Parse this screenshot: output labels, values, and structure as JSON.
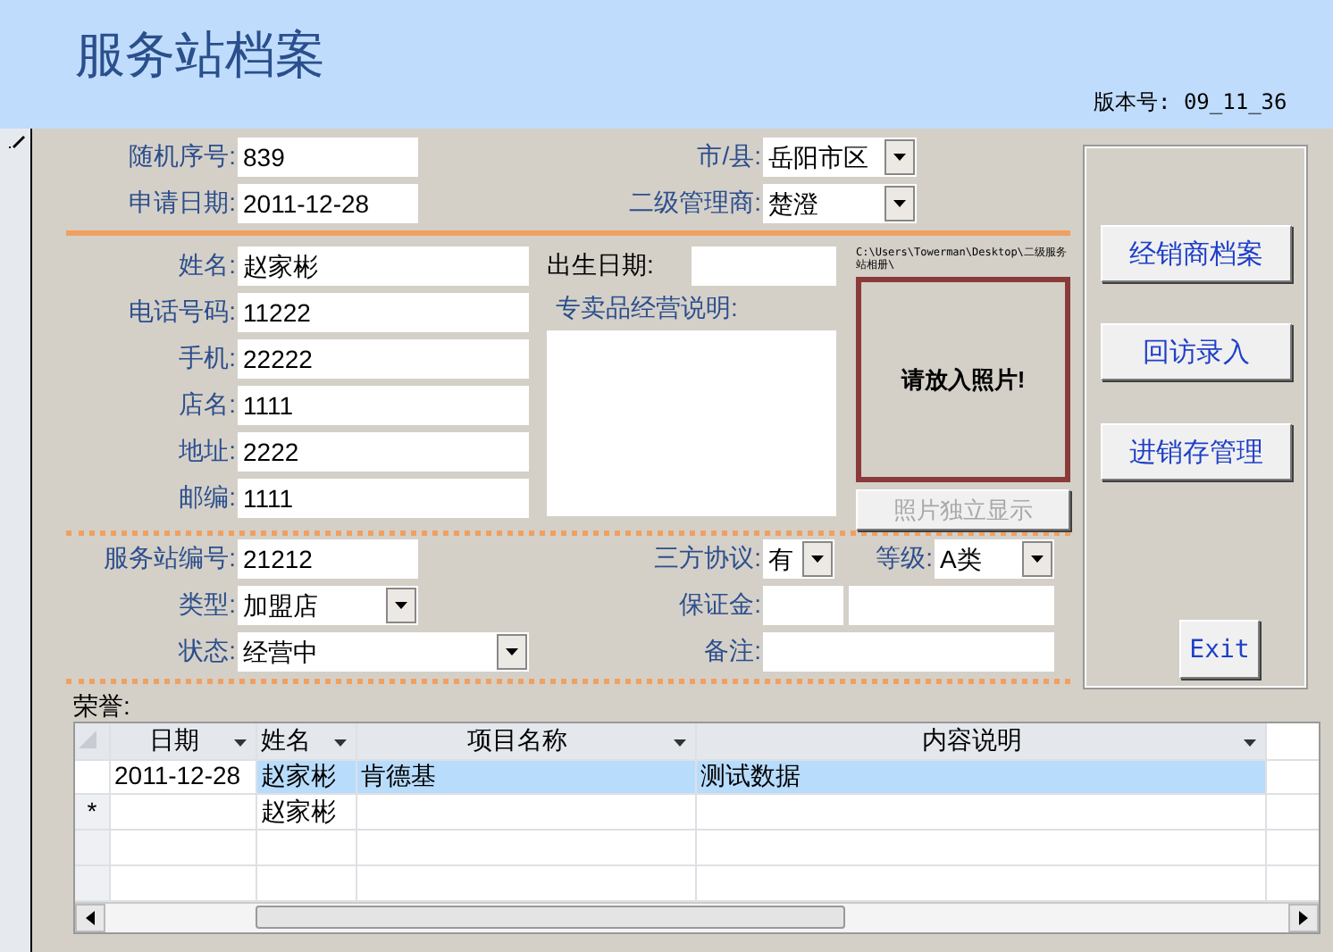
{
  "header": {
    "title": "服务站档案",
    "version": "版本号: 09_11_36"
  },
  "top_fields": [
    {
      "label": "随机序号:",
      "value": "839",
      "kind": "text"
    },
    {
      "label": "市/县:",
      "value": "岳阳市区",
      "kind": "combo"
    },
    {
      "label": "申请日期:",
      "value": "2011-12-28",
      "kind": "text"
    },
    {
      "label": "二级管理商:",
      "value": "楚澄",
      "kind": "combo"
    }
  ],
  "contact_fields": [
    {
      "label": "姓名:",
      "value": "赵家彬"
    },
    {
      "label": "电话号码:",
      "value": "11222"
    },
    {
      "label": "手机:",
      "value": "22222"
    },
    {
      "label": "店名:",
      "value": "1111"
    },
    {
      "label": "地址:",
      "value": "2222"
    },
    {
      "label": "邮编:",
      "value": "1111"
    }
  ],
  "birth_date": {
    "label": "出生日期:"
  },
  "specialty_note": {
    "label": "专卖品经营说明:"
  },
  "photo": {
    "path": "C:\\Users\\Towerman\\Desktop\\二级服务站相册\\",
    "placeholder": "请放入照片!",
    "button": {
      "label": "照片独立显示",
      "disabled": true
    }
  },
  "station_fields": [
    {
      "label": "服务站编号:",
      "value": "21212",
      "kind": "text"
    },
    {
      "label": "三方协议:",
      "value": "有",
      "kind": "combo"
    },
    {
      "label": "等级:",
      "value": "A类",
      "kind": "combo"
    },
    {
      "label": "类型:",
      "value": "加盟店",
      "kind": "combo"
    },
    {
      "label": "保证金:",
      "kind": "text"
    },
    {
      "kind": "text"
    },
    {
      "label": "状态:",
      "value": "经营中",
      "kind": "combo"
    },
    {
      "label": "备注:",
      "kind": "text"
    }
  ],
  "side_buttons": [
    "经销商档案",
    "回访录入",
    "进销存管理"
  ],
  "exit_button": "Exit",
  "honors": {
    "label": "荣誉:",
    "columns": [
      "日期",
      "姓名",
      "项目名称",
      "内容说明"
    ],
    "rows": [
      {
        "marker": null,
        "selected": true,
        "cells": [
          "2011-12-28",
          "赵家彬",
          "肯德基",
          "测试数据"
        ]
      },
      {
        "marker": "*",
        "selected": false,
        "cells": [
          null,
          "赵家彬",
          null,
          null
        ]
      }
    ]
  }
}
